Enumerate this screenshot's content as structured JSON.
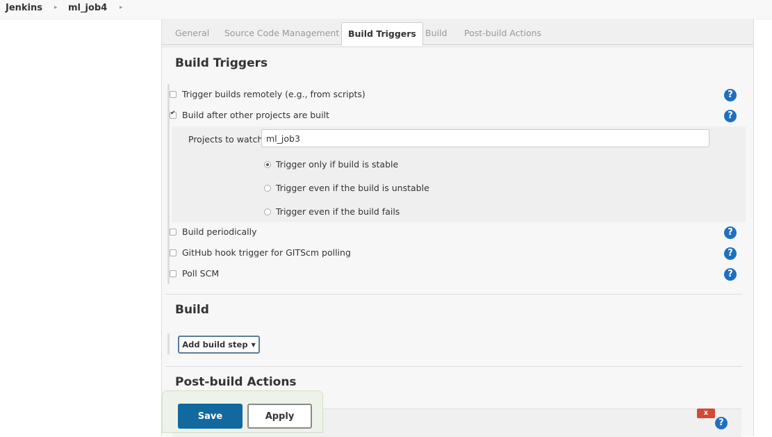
{
  "breadcrumb": {
    "root": "Jenkins",
    "job": "ml_job4"
  },
  "tabs": [
    "General",
    "Source Code Management",
    "Build Triggers",
    "Build",
    "Post-build Actions"
  ],
  "active_tab": "Build Triggers",
  "triggers": {
    "title": "Build Triggers",
    "items": [
      {
        "label": "Trigger builds remotely (e.g., from scripts)",
        "checked": false
      },
      {
        "label": "Build after other projects are built",
        "checked": true
      },
      {
        "label": "Build periodically",
        "checked": false
      },
      {
        "label": "GitHub hook trigger for GITScm polling",
        "checked": false
      },
      {
        "label": "Poll SCM",
        "checked": false
      }
    ],
    "projects_label": "Projects to watch",
    "projects_value": "ml_job3",
    "radios": [
      {
        "label": "Trigger only if build is stable",
        "selected": true
      },
      {
        "label": "Trigger even if the build is unstable",
        "selected": false
      },
      {
        "label": "Trigger even if the build fails",
        "selected": false
      }
    ]
  },
  "build": {
    "title": "Build",
    "add_step_label": "Add build step"
  },
  "post_build": {
    "title": "Post-build Actions",
    "delete_label": "x"
  },
  "help_label": "?",
  "buttons": {
    "save": "Save",
    "apply": "Apply"
  },
  "colors": {
    "save_bg": "#12699f",
    "help_bg": "#1f6fc1",
    "delete_bg": "#d24939"
  }
}
